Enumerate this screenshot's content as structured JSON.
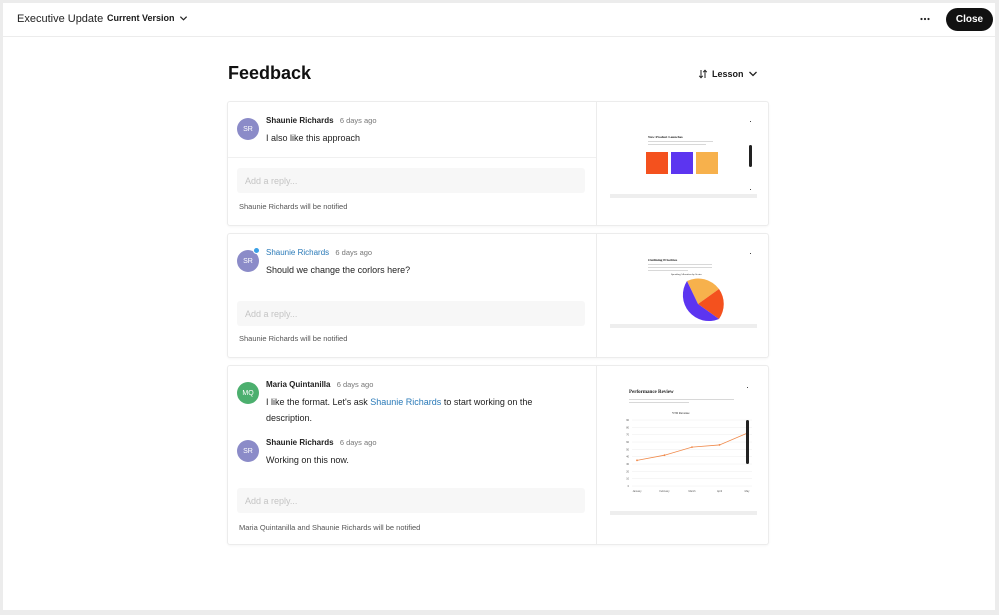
{
  "header": {
    "app_title": "Executive Update",
    "version_label": "Current Version",
    "close_label": "Close"
  },
  "page": {
    "title": "Feedback",
    "sort_label": "Lesson"
  },
  "reply_placeholder": "Add a reply...",
  "threads": [
    {
      "comments": [
        {
          "initials": "SR",
          "author": "Shaunie Richards",
          "time": "6 days ago",
          "text": "I also like this approach"
        }
      ],
      "notified": "Shaunie Richards will be notified",
      "slide": {
        "title": "New Product Launches",
        "tiles": [
          "#f4511e",
          "#5c35f0",
          "#f7b14c"
        ]
      }
    },
    {
      "comments": [
        {
          "initials": "SR",
          "author": "Shaunie Richards",
          "time": "6 days ago",
          "text": "Should we change the corlors here?"
        }
      ],
      "notified": "Shaunie Richards will be notified",
      "slide": {
        "title": "Outlining Priorities",
        "subtitle": "Spending Allocation by Sector"
      }
    },
    {
      "comments": [
        {
          "initials": "MQ",
          "author": "Maria Quintanilla",
          "time": "6 days ago",
          "text_before": "I like the format. Let's ask ",
          "mention": "Shaunie Richards",
          "text_after": " to start working on the description."
        },
        {
          "initials": "SR",
          "author": "Shaunie Richards",
          "time": "6 days ago",
          "text": "Working on this now."
        }
      ],
      "notified": "Maria Quintanilla and Shaunie Richards will be notified",
      "slide": {
        "title": "Performance Review",
        "subtitle": "YTD Revenue",
        "chart_data": {
          "type": "line",
          "categories": [
            "January",
            "February",
            "March",
            "April",
            "May"
          ],
          "values": [
            35,
            42,
            53,
            56,
            72
          ],
          "ylim": [
            0,
            90
          ]
        }
      }
    }
  ],
  "colors": {
    "avatar_sr": "#8b8bc8",
    "avatar_mq": "#4caf6e",
    "accent_link": "#2a7ab8",
    "online": "#3aa0e6",
    "close_bg": "#111111",
    "pie_purple": "#5c35f0",
    "pie_orange": "#f4511e",
    "pie_yellow": "#f7b14c",
    "line_orange": "#f08a4b"
  },
  "icons": {
    "version": "chevron-down-icon",
    "more": "more-horizontal-icon",
    "sort": "sort-icon"
  }
}
